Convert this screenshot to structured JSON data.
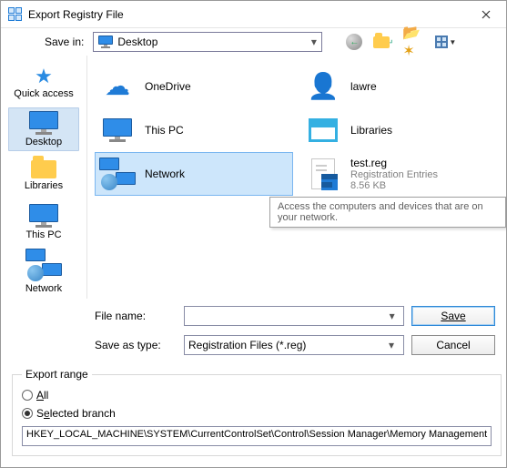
{
  "title": "Export Registry File",
  "topbar": {
    "save_in_label": "Save in:",
    "location": "Desktop"
  },
  "places": [
    {
      "id": "quick",
      "label": "Quick access"
    },
    {
      "id": "desktop",
      "label": "Desktop"
    },
    {
      "id": "libraries",
      "label": "Libraries"
    },
    {
      "id": "thispc",
      "label": "This PC"
    },
    {
      "id": "network",
      "label": "Network"
    }
  ],
  "left_col": [
    {
      "name": "OneDrive"
    },
    {
      "name": "This PC"
    },
    {
      "name": "Network"
    }
  ],
  "right_col": [
    {
      "name": "lawre"
    },
    {
      "name": "Libraries"
    },
    {
      "name": "test.reg",
      "sub1": "Registration Entries",
      "sub2": "8.56 KB"
    }
  ],
  "tooltip": "Access the computers and devices that are on your network.",
  "bottom": {
    "file_name_label": "File name:",
    "file_name": "",
    "type_label": "Save as type:",
    "type_value": "Registration Files (*.reg)",
    "save": "Save",
    "cancel": "Cancel"
  },
  "export_range": {
    "legend": "Export range",
    "all": "All",
    "selected": "Selected branch",
    "branch": "HKEY_LOCAL_MACHINE\\SYSTEM\\CurrentControlSet\\Control\\Session Manager\\Memory Management"
  }
}
